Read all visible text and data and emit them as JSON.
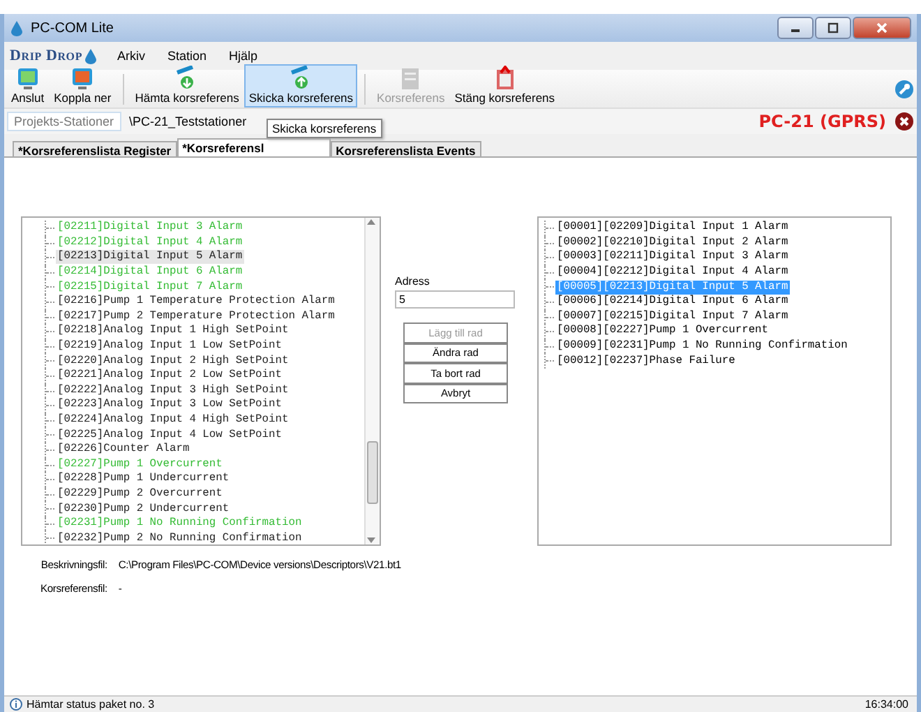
{
  "window": {
    "title": "PC-COM Lite"
  },
  "logo": "Drip Drop",
  "menu": [
    "Arkiv",
    "Station",
    "Hjälp"
  ],
  "toolbar": [
    [
      {
        "label": "Anslut",
        "kind": "connect",
        "disabled": false,
        "selected": false
      },
      {
        "label": "Koppla ner",
        "kind": "disconnect",
        "disabled": false,
        "selected": false
      }
    ],
    [
      {
        "label": "Hämta korsreferens",
        "kind": "fetch",
        "disabled": false,
        "selected": false
      },
      {
        "label": "Skicka korsreferens",
        "kind": "send",
        "disabled": false,
        "selected": true
      }
    ],
    [
      {
        "label": "Korsreferens",
        "kind": "document",
        "disabled": true,
        "selected": false
      },
      {
        "label": "Stäng korsreferens",
        "kind": "close",
        "disabled": false,
        "selected": false
      }
    ]
  ],
  "breadcrumb": [
    "Projekts-Stationer",
    "\\PC-21_Teststationer"
  ],
  "station": {
    "label": "PC-21 (GPRS)"
  },
  "tabs": [
    {
      "label": "*Korsreferenslista Register",
      "selected": false
    },
    {
      "label": "*Korsreferensl",
      "selected": true
    },
    {
      "label": "Korsreferenslista Events",
      "selected": false
    }
  ],
  "tooltip": "Skicka korsreferens",
  "left_list": [
    {
      "text": "[02211]Digital Input 3 Alarm",
      "color": "#33bb33",
      "selected": false
    },
    {
      "text": "[02212]Digital Input 4 Alarm",
      "color": "#33bb33",
      "selected": false
    },
    {
      "text": "[02213]Digital Input 5 Alarm",
      "color": "#222222",
      "selected": true
    },
    {
      "text": "[02214]Digital Input 6 Alarm",
      "color": "#33bb33",
      "selected": false
    },
    {
      "text": "[02215]Digital Input 7 Alarm",
      "color": "#33bb33",
      "selected": false
    },
    {
      "text": "[02216]Pump 1 Temperature Protection Alarm",
      "color": "#222222",
      "selected": false
    },
    {
      "text": "[02217]Pump 2 Temperature Protection Alarm",
      "color": "#222222",
      "selected": false
    },
    {
      "text": "[02218]Analog Input 1 High SetPoint",
      "color": "#222222",
      "selected": false
    },
    {
      "text": "[02219]Analog Input 1 Low SetPoint",
      "color": "#222222",
      "selected": false
    },
    {
      "text": "[02220]Analog Input 2 High SetPoint",
      "color": "#222222",
      "selected": false
    },
    {
      "text": "[02221]Analog Input 2 Low SetPoint",
      "color": "#222222",
      "selected": false
    },
    {
      "text": "[02222]Analog Input 3 High SetPoint",
      "color": "#222222",
      "selected": false
    },
    {
      "text": "[02223]Analog Input 3 Low SetPoint",
      "color": "#222222",
      "selected": false
    },
    {
      "text": "[02224]Analog Input 4 High SetPoint",
      "color": "#222222",
      "selected": false
    },
    {
      "text": "[02225]Analog Input 4 Low SetPoint",
      "color": "#222222",
      "selected": false
    },
    {
      "text": "[02226]Counter Alarm",
      "color": "#222222",
      "selected": false
    },
    {
      "text": "[02227]Pump 1 Overcurrent",
      "color": "#33bb33",
      "selected": false
    },
    {
      "text": "[02228]Pump 1 Undercurrent",
      "color": "#222222",
      "selected": false
    },
    {
      "text": "[02229]Pump 2 Overcurrent",
      "color": "#222222",
      "selected": false
    },
    {
      "text": "[02230]Pump 2 Undercurrent",
      "color": "#222222",
      "selected": false
    },
    {
      "text": "[02231]Pump 1 No Running Confirmation",
      "color": "#33bb33",
      "selected": false
    },
    {
      "text": "[02232]Pump 2 No Running Confirmation",
      "color": "#222222",
      "selected": false
    }
  ],
  "address": {
    "label": "Adress",
    "value": "5"
  },
  "buttons": [
    {
      "label": "Lägg till rad",
      "disabled": true
    },
    {
      "label": "Ändra rad",
      "disabled": false
    },
    {
      "label": "Ta bort rad",
      "disabled": false
    },
    {
      "label": "Avbryt",
      "disabled": false
    }
  ],
  "right_list": [
    {
      "text": "[00001][02209]Digital Input 1 Alarm",
      "selected": false
    },
    {
      "text": "[00002][02210]Digital Input 2 Alarm",
      "selected": false
    },
    {
      "text": "[00003][02211]Digital Input 3 Alarm",
      "selected": false
    },
    {
      "text": "[00004][02212]Digital Input 4 Alarm",
      "selected": false
    },
    {
      "text": "[00005][02213]Digital Input 5 Alarm",
      "selected": true
    },
    {
      "text": "[00006][02214]Digital Input 6 Alarm",
      "selected": false
    },
    {
      "text": "[00007][02215]Digital Input 7 Alarm",
      "selected": false
    },
    {
      "text": "[00008][02227]Pump 1 Overcurrent",
      "selected": false
    },
    {
      "text": "[00009][02231]Pump 1 No Running Confirmation",
      "selected": false
    },
    {
      "text": "[00012][02237]Phase Failure",
      "selected": false
    }
  ],
  "files": [
    {
      "label": "Beskrivningsfil:",
      "value": "C:\\Program Files\\PC-COM\\Device versions\\Descriptors\\V21.bt1"
    },
    {
      "label": "Korsreferensfil:",
      "value": "-"
    }
  ],
  "status_bar": {
    "message": "Hämtar status paket no. 3",
    "time": "16:34:00"
  }
}
